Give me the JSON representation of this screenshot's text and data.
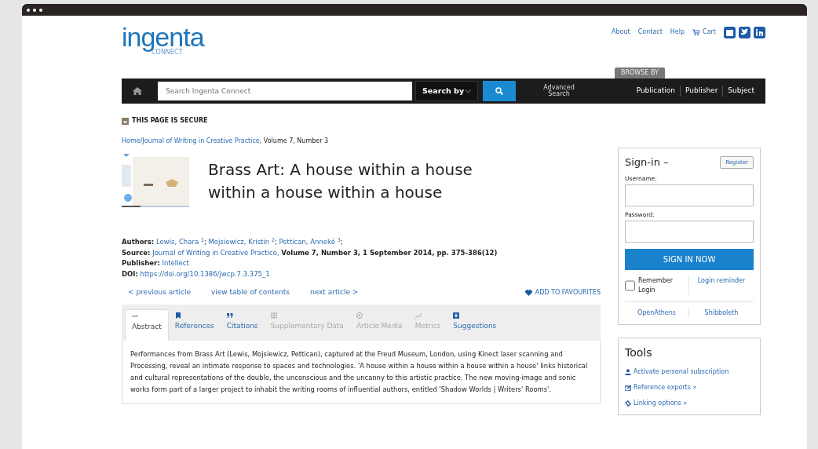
{
  "logo": {
    "word": "ingenta",
    "sub": "CONNECT"
  },
  "top_links": [
    "About",
    "Contact",
    "Help"
  ],
  "cart": "Cart",
  "search": {
    "placeholder": "Search Ingenta Connect",
    "search_by": "Search by",
    "advanced": "Advanced Search"
  },
  "browse": {
    "label": "BROWSE BY",
    "items": [
      "Publication",
      "Publisher",
      "Subject"
    ]
  },
  "secure": "THIS PAGE IS SECURE",
  "breadcrumb": {
    "links": [
      "Home",
      "Journal of Writing in Creative Practice"
    ],
    "sep": "/",
    "rest": ", Volume 7, Number 3"
  },
  "article": {
    "title": "Brass Art: A house within a house within a house within a house",
    "authors_label": "Authors:",
    "authors": [
      {
        "name": "Lewis, Chara",
        "note": "1",
        "sep": ";"
      },
      {
        "name": "Mojsiewicz, Kristin",
        "note": "2",
        "sep": ";"
      },
      {
        "name": "Pettican, Anneké",
        "note": "3",
        "sep": ";"
      }
    ],
    "source_label": "Source:",
    "source_link": "Journal of Writing in Creative Practice,",
    "source_rest": "Volume 7, Number 3, 1 September 2014, pp. 375-386(12)",
    "publisher_label": "Publisher:",
    "publisher": "Intellect",
    "doi_label": "DOI:",
    "doi": "https://doi.org/10.1386/jwcp.7.3.375_1"
  },
  "article_nav": [
    "< previous article",
    "view table of contents",
    "next article >"
  ],
  "favourites": "ADD TO FAVOURITES",
  "tabs": [
    {
      "label": "Abstract",
      "selected": true,
      "disabled": false
    },
    {
      "label": "References",
      "selected": false,
      "disabled": false
    },
    {
      "label": "Citations",
      "selected": false,
      "disabled": false
    },
    {
      "label": "Supplementary Data",
      "selected": false,
      "disabled": true
    },
    {
      "label": "Article Media",
      "selected": false,
      "disabled": true
    },
    {
      "label": "Metrics",
      "selected": false,
      "disabled": true
    },
    {
      "label": "Suggestions",
      "selected": false,
      "disabled": false
    }
  ],
  "abstract": "Performances from Brass Art (Lewis, Mojsiewicz, Pettican), captured at the Freud Museum, London, using Kinect laser scanning and Processing, reveal an intimate response to spaces and technologies. 'A house within a house within a house within a house' links historical and cultural representations of the double, the unconscious and the uncanny to this artistic practice. The new moving-image and sonic works form part of a larger project to inhabit the writing rooms of influential authors, entitled 'Shadow Worlds | Writers' Rooms'.",
  "signin": {
    "title": "Sign-in –",
    "register": "Register",
    "username_label": "Username:",
    "password_label": "Password:",
    "button": "SIGN IN NOW",
    "remember": "Remember Login",
    "remember_checked": false,
    "reminder": "Login reminder",
    "alt": [
      "OpenAthens",
      "Shibboleth"
    ]
  },
  "tools": {
    "title": "Tools",
    "items": [
      "Activate personal subscription",
      "Reference exports »",
      "Linking options »"
    ]
  }
}
